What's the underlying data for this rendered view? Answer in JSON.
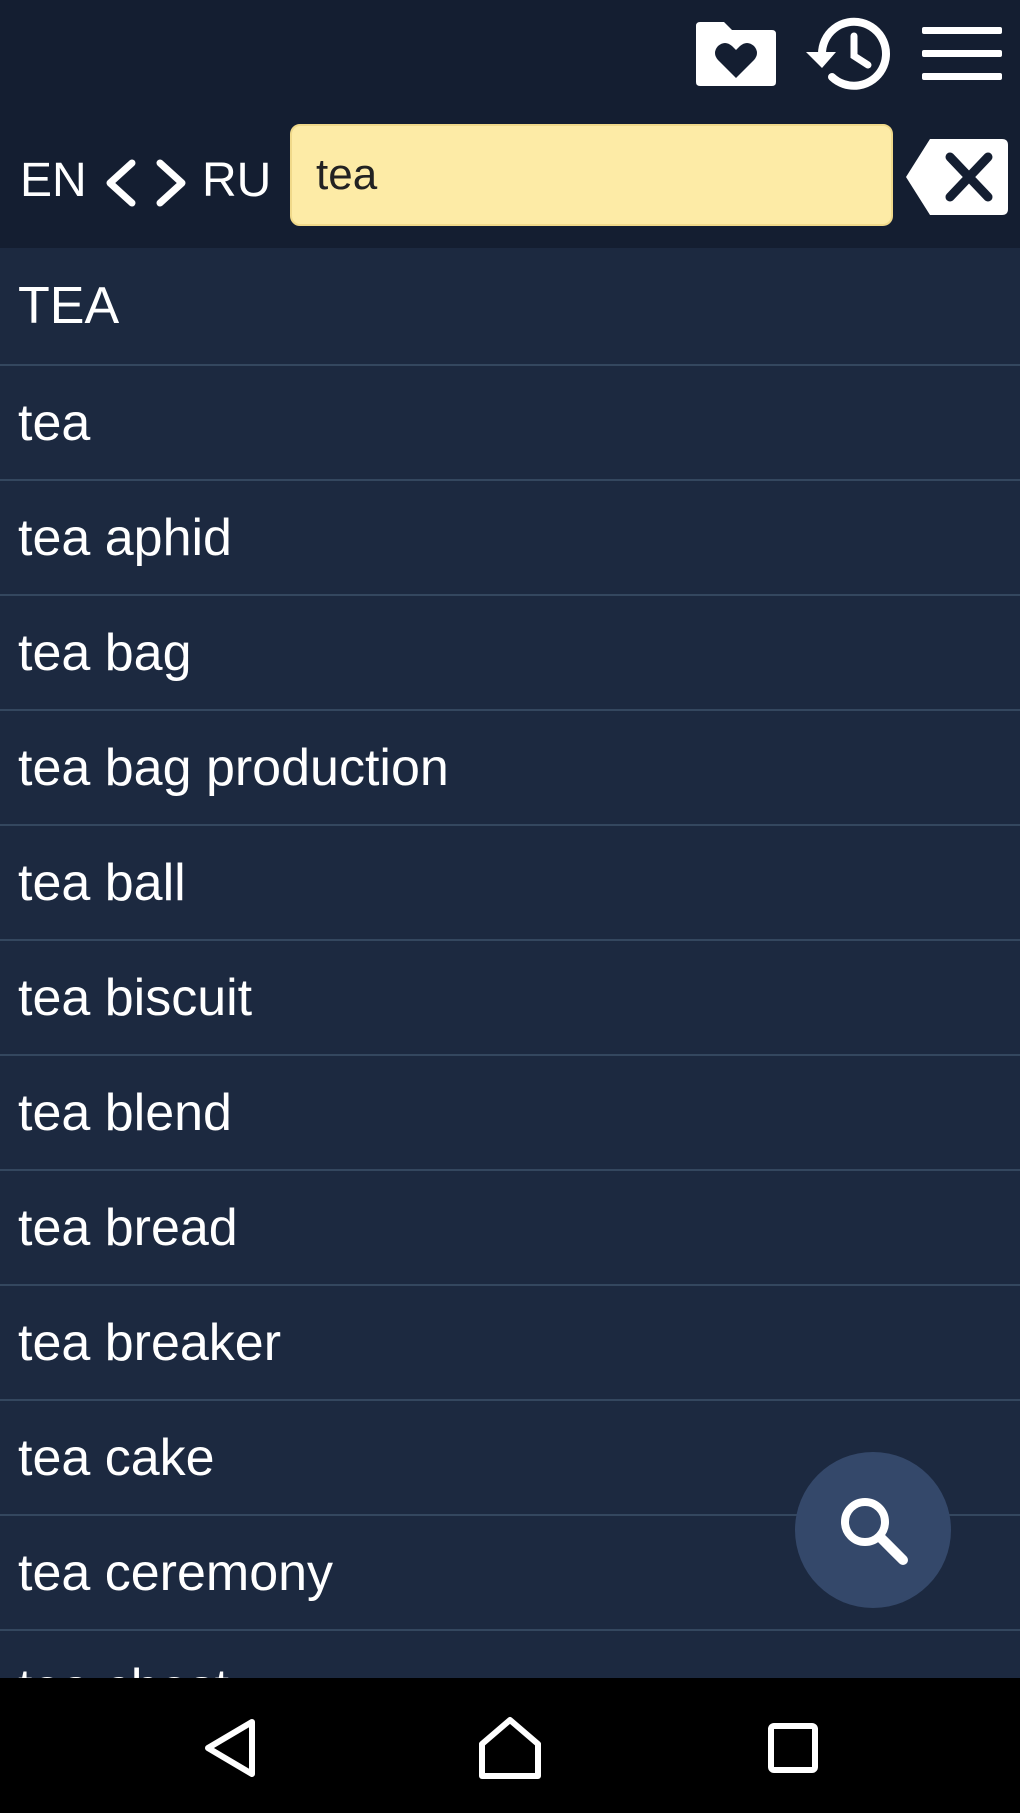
{
  "toolbar": {
    "icons": [
      "favorites-folder-icon",
      "history-icon",
      "menu-icon"
    ]
  },
  "search": {
    "lang_from": "EN",
    "lang_to": "RU",
    "query": "tea"
  },
  "results": [
    "TEA",
    "tea",
    "tea aphid",
    "tea bag",
    "tea bag production",
    "tea ball",
    "tea biscuit",
    "tea blend",
    "tea bread",
    "tea breaker",
    "tea cake",
    "tea ceremony",
    "tea chest"
  ],
  "colors": {
    "toolbar_bg": "#141e31",
    "list_bg": "#1c2940",
    "divider": "#34475f",
    "search_field_bg": "#fdeba6",
    "fab_bg": "#34486a",
    "nav_bg": "#000000"
  }
}
